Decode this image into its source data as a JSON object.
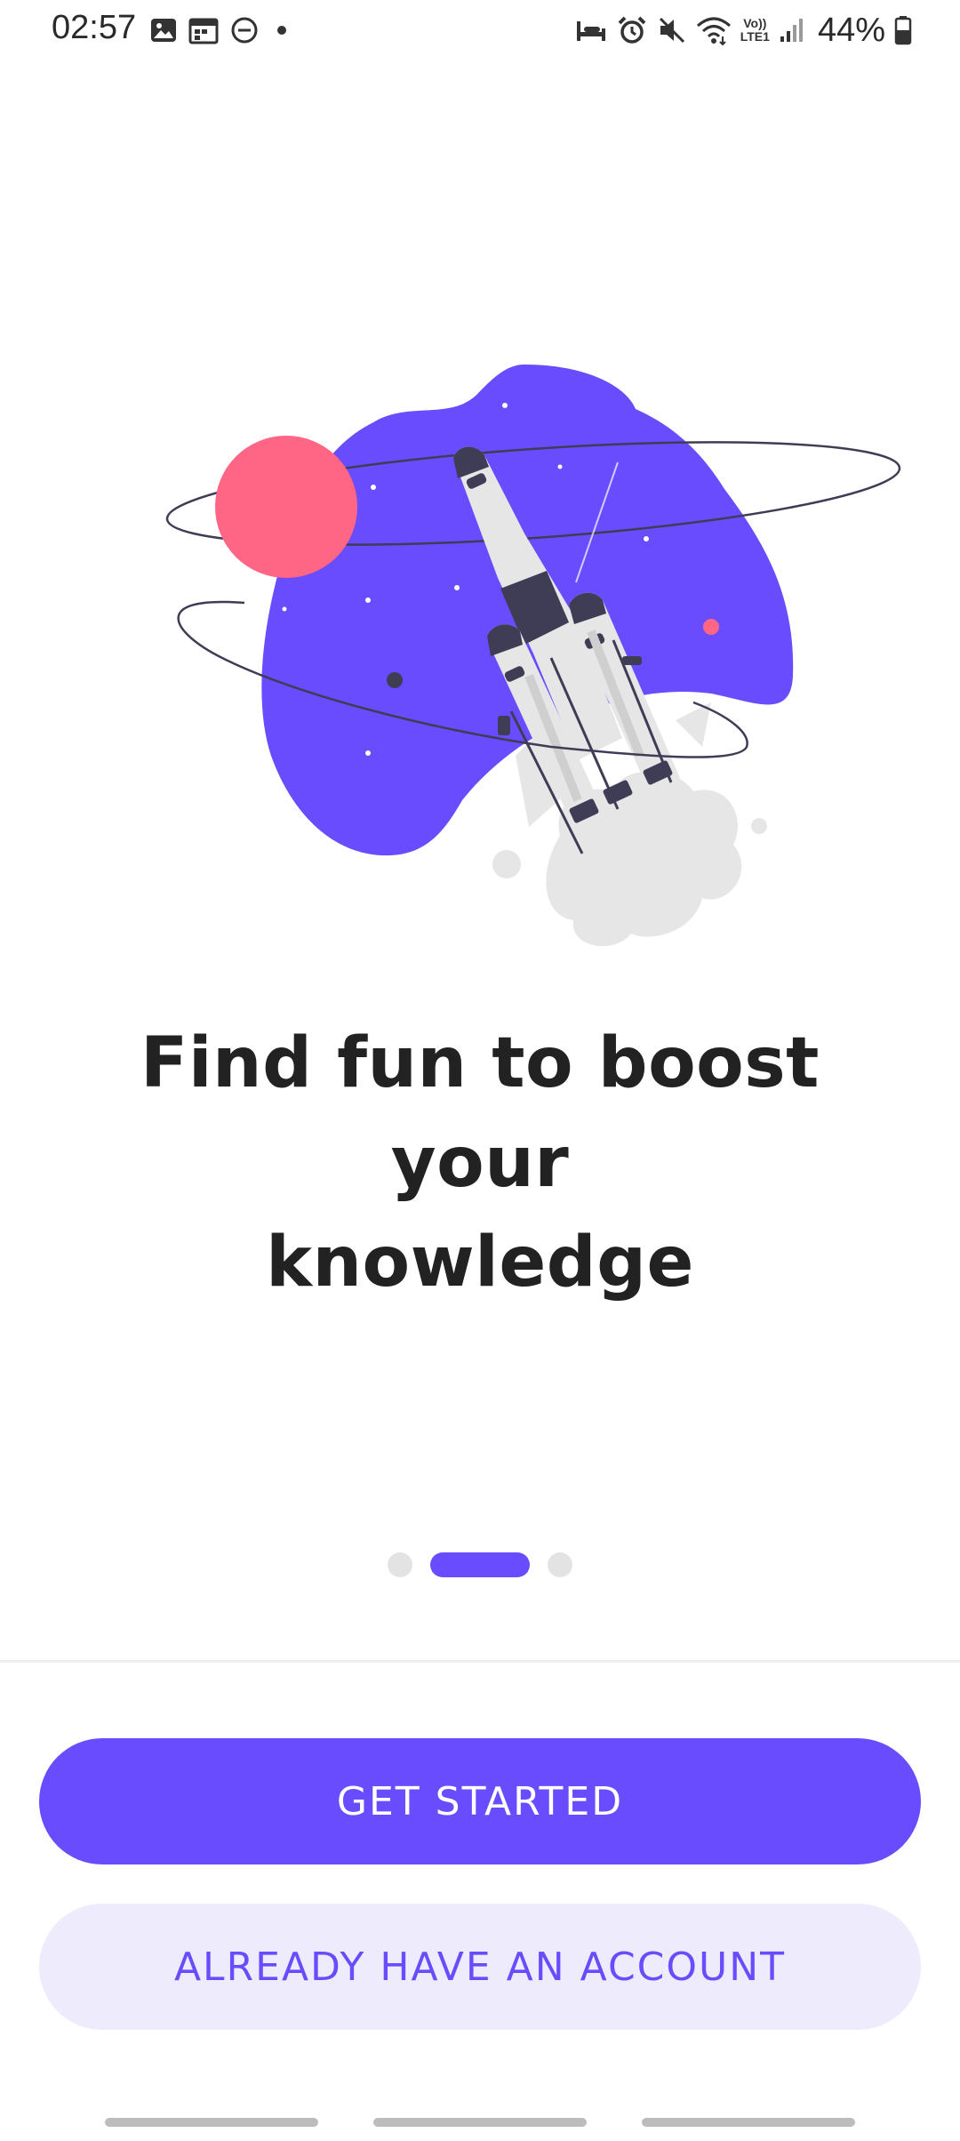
{
  "status_bar": {
    "time": "02:57",
    "battery_text": "44%",
    "network_label_top": "Vo))",
    "network_label_bottom": "LTE1",
    "left_icons": [
      "gallery-icon",
      "calendar-icon",
      "dnd-icon",
      "notification-dot-icon"
    ],
    "right_icons": [
      "sleep-icon",
      "alarm-icon",
      "mute-icon",
      "wifi-icon",
      "volte-icon",
      "signal-icon",
      "battery-icon"
    ]
  },
  "onboarding": {
    "headline_line1": "Find fun to boost your",
    "headline_line2": "knowledge",
    "illustration": "rocket-launch-illustration",
    "pager": {
      "count": 3,
      "active_index": 1
    }
  },
  "actions": {
    "primary_label": "GET STARTED",
    "secondary_label": "ALREADY HAVE AN ACCOUNT"
  },
  "colors": {
    "accent": "#6a4cff",
    "accent_light": "#eeebfd",
    "planet": "#ff6584",
    "rocket_dark": "#3f3d56",
    "smoke": "#e6e6e6"
  }
}
